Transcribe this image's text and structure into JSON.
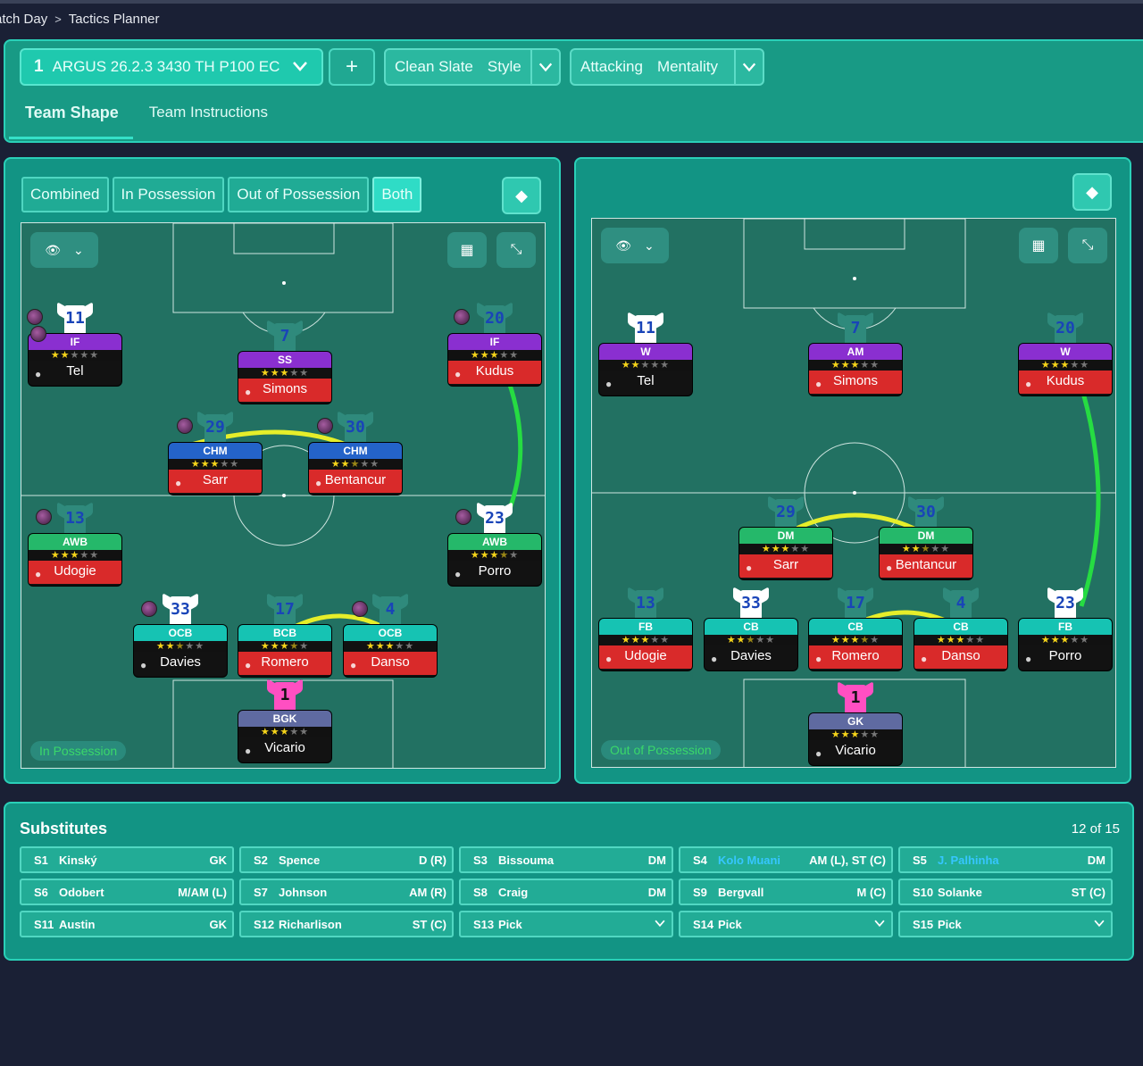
{
  "breadcrumb": {
    "item1": "atch Day",
    "sep": ">",
    "item2": "Tactics Planner"
  },
  "header": {
    "tactic_number": "1",
    "tactic_name": "ARGUS 26.2.3 3430 TH P100 EC",
    "plus": "+",
    "style": {
      "value": "Clean Slate",
      "label": "Style"
    },
    "mentality": {
      "value": "Attacking",
      "label": "Mentality"
    },
    "tabs": [
      "Team Shape",
      "Team Instructions"
    ]
  },
  "left_panel": {
    "segments": [
      "Combined",
      "In Possession",
      "Out of Possession",
      "Both"
    ],
    "active_segment": "Both",
    "pitch_label": "In Possession",
    "players": [
      {
        "num": "11",
        "role": "IF",
        "stars": 2,
        "name": "Tel",
        "status": "blk",
        "role_color": "purple",
        "shirt": "white",
        "ball": true
      },
      {
        "num": "7",
        "role": "SS",
        "stars": 3,
        "name": "Simons",
        "status": "red",
        "role_color": "purple",
        "shirt": "ghost",
        "ball": true
      },
      {
        "num": "20",
        "role": "IF",
        "stars": 3,
        "name": "Kudus",
        "status": "red",
        "role_color": "purple",
        "shirt": "ghost",
        "ball": true
      },
      {
        "num": "29",
        "role": "CHM",
        "stars": 3,
        "name": "Sarr",
        "status": "red",
        "role_color": "blue",
        "shirt": "ghost",
        "ball": true
      },
      {
        "num": "30",
        "role": "CHM",
        "stars": 2.5,
        "name": "Bentancur",
        "status": "red",
        "role_color": "blue",
        "shirt": "ghost",
        "ball": true
      },
      {
        "num": "13",
        "role": "AWB",
        "stars": 3,
        "name": "Udogie",
        "status": "red",
        "role_color": "green",
        "shirt": "ghost",
        "ball": true
      },
      {
        "num": "23",
        "role": "AWB",
        "stars": 3.5,
        "name": "Porro",
        "status": "blk",
        "role_color": "green",
        "shirt": "white",
        "ball": true
      },
      {
        "num": "33",
        "role": "OCB",
        "stars": 2.5,
        "name": "Davies",
        "status": "blk",
        "role_color": "teal",
        "shirt": "white",
        "ball": true
      },
      {
        "num": "17",
        "role": "BCB",
        "stars": 3.5,
        "name": "Romero",
        "status": "red",
        "role_color": "teal",
        "shirt": "ghost",
        "ball": false
      },
      {
        "num": "4",
        "role": "OCB",
        "stars": 3,
        "name": "Danso",
        "status": "red",
        "role_color": "teal",
        "shirt": "ghost",
        "ball": true
      },
      {
        "num": "1",
        "role": "BGK",
        "stars": 3,
        "name": "Vicario",
        "status": "blk",
        "role_color": "grey",
        "shirt": "pink",
        "ball": false
      }
    ]
  },
  "right_panel": {
    "pitch_label": "Out of Possession",
    "players": [
      {
        "num": "11",
        "role": "W",
        "stars": 2,
        "name": "Tel",
        "status": "blk",
        "role_color": "purple",
        "shirt": "white"
      },
      {
        "num": "7",
        "role": "AM",
        "stars": 3,
        "name": "Simons",
        "status": "red",
        "role_color": "purple",
        "shirt": "ghost"
      },
      {
        "num": "20",
        "role": "W",
        "stars": 3,
        "name": "Kudus",
        "status": "red",
        "role_color": "purple",
        "shirt": "ghost"
      },
      {
        "num": "29",
        "role": "DM",
        "stars": 3,
        "name": "Sarr",
        "status": "red",
        "role_color": "green",
        "shirt": "ghost"
      },
      {
        "num": "30",
        "role": "DM",
        "stars": 2.5,
        "name": "Bentancur",
        "status": "red",
        "role_color": "green",
        "shirt": "ghost"
      },
      {
        "num": "13",
        "role": "FB",
        "stars": 3,
        "name": "Udogie",
        "status": "red",
        "role_color": "teal",
        "shirt": "ghost"
      },
      {
        "num": "33",
        "role": "CB",
        "stars": 2.5,
        "name": "Davies",
        "status": "blk",
        "role_color": "teal",
        "shirt": "white"
      },
      {
        "num": "17",
        "role": "CB",
        "stars": 3.5,
        "name": "Romero",
        "status": "red",
        "role_color": "teal",
        "shirt": "ghost"
      },
      {
        "num": "4",
        "role": "CB",
        "stars": 3,
        "name": "Danso",
        "status": "red",
        "role_color": "teal",
        "shirt": "ghost"
      },
      {
        "num": "23",
        "role": "FB",
        "stars": 3,
        "name": "Porro",
        "status": "blk",
        "role_color": "teal",
        "shirt": "white"
      },
      {
        "num": "1",
        "role": "GK",
        "stars": 3,
        "name": "Vicario",
        "status": "blk",
        "role_color": "grey",
        "shirt": "pink"
      }
    ]
  },
  "substitutes": {
    "title": "Substitutes",
    "count": "12 of 15",
    "items": [
      {
        "slot": "S1",
        "name": "Kinský",
        "pos": "GK"
      },
      {
        "slot": "S2",
        "name": "Spence",
        "pos": "D (R)"
      },
      {
        "slot": "S3",
        "name": "Bissouma",
        "pos": "DM"
      },
      {
        "slot": "S4",
        "name": "Kolo Muani",
        "pos": "AM (L), ST (C)",
        "highlight": true
      },
      {
        "slot": "S5",
        "name": "J. Palhinha",
        "pos": "DM",
        "highlight": true
      },
      {
        "slot": "S6",
        "name": "Odobert",
        "pos": "M/AM (L)"
      },
      {
        "slot": "S7",
        "name": "Johnson",
        "pos": "AM (R)"
      },
      {
        "slot": "S8",
        "name": "Craig",
        "pos": "DM"
      },
      {
        "slot": "S9",
        "name": "Bergvall",
        "pos": "M (C)"
      },
      {
        "slot": "S10",
        "name": "Solanke",
        "pos": "ST (C)"
      },
      {
        "slot": "S11",
        "name": "Austin",
        "pos": "GK"
      },
      {
        "slot": "S12",
        "name": "Richarlison",
        "pos": "ST (C)"
      },
      {
        "slot": "S13",
        "name": "Pick",
        "pos": "",
        "dropdown": true
      },
      {
        "slot": "S14",
        "name": "Pick",
        "pos": "",
        "dropdown": true
      },
      {
        "slot": "S15",
        "name": "Pick",
        "pos": "",
        "dropdown": true
      }
    ]
  }
}
